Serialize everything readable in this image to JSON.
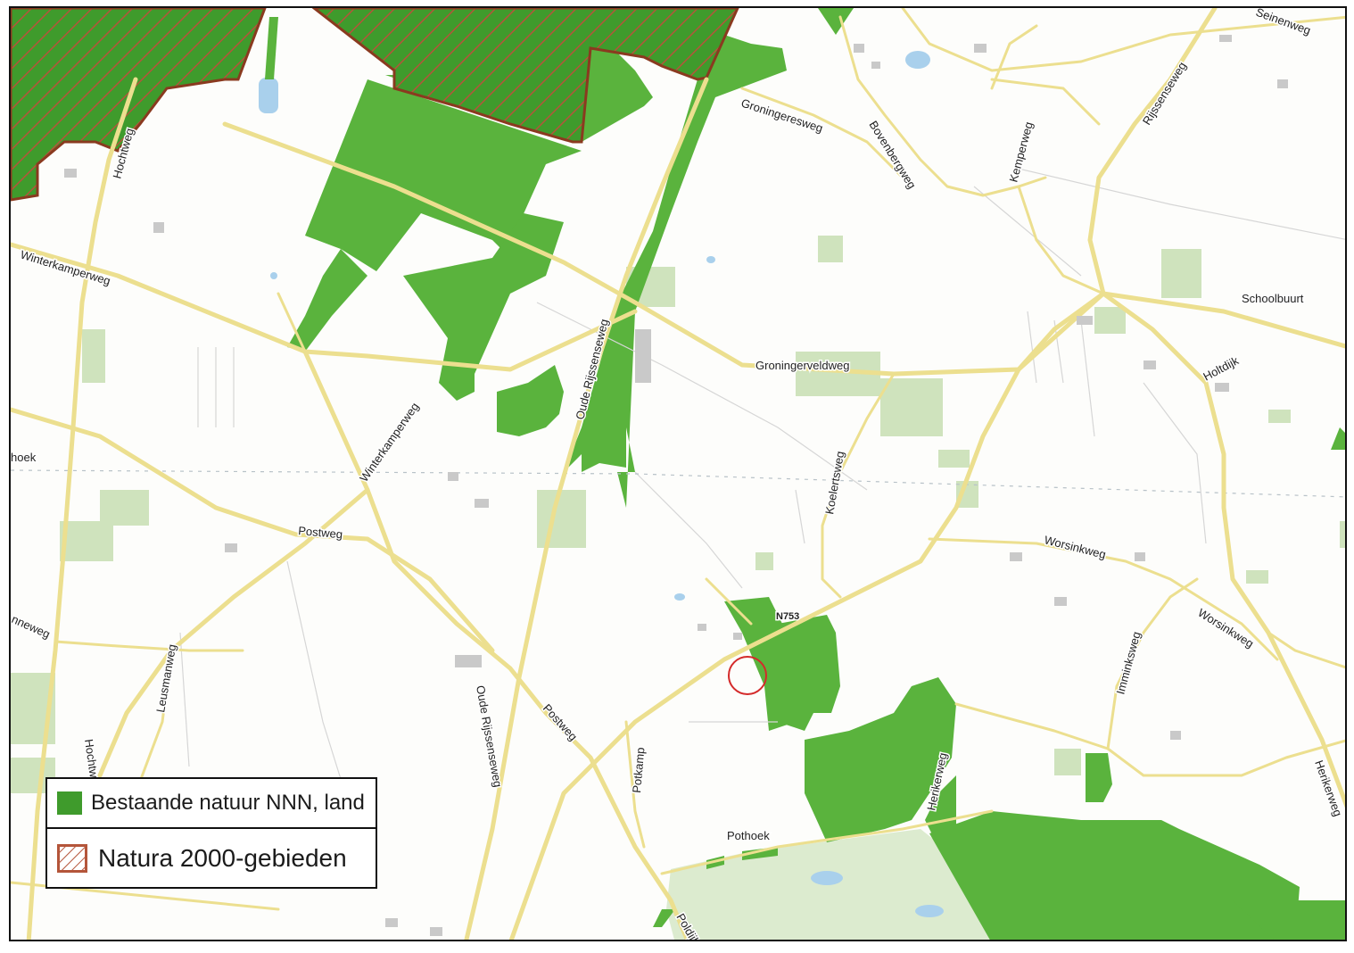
{
  "map": {
    "labels": {
      "winterkamperweg_nw": "Winterkamperweg",
      "winterkamperweg_c": "Winterkamperweg",
      "hochtweg_n": "Hochtweg",
      "hochtweg_s": "Hochtweg",
      "groningeresweg": "Groningeresweg",
      "bovenbergweg": "Bovenbergweg",
      "kemperweg": "Kemperweg",
      "rijssenseweg_ne": "Rijssenseweg",
      "seinenweg": "Seinenweg",
      "schoolbuurt": "Schoolbuurt",
      "holtdijk": "Holtdijk",
      "groningerveldweg": "Groningerveldweg",
      "oude_rijssenseweg_n": "Oude Rijssenseweg",
      "oude_rijssenseweg_s": "Oude Rijssenseweg",
      "koelertsweg": "Koelertsweg",
      "worsinkweg_n": "Worsinkweg",
      "worsinkweg_s": "Worsinkweg",
      "hoek": "hoek",
      "postweg_w": "Postweg",
      "postweg_s": "Postweg",
      "nneweg": "nneweg",
      "leusmanweg": "Leusmanweg",
      "potkamp": "Potkamp",
      "n753": "N753",
      "imminksweg": "Imminksweg",
      "herikerweg_c": "Herikerweg",
      "herikerweg_e": "Herikerweg",
      "pothoek": "Pothoek",
      "poldijk": "Poldijk"
    },
    "marker": {
      "shape": "circle",
      "color": "#d42a2a"
    },
    "colors": {
      "nnn_fill": "#5ab33d",
      "natura_fill": "#3f9b2c",
      "natura_hatch": "#b4553a",
      "natura_border": "#8a3a1f",
      "road": "#ecdf8f",
      "water": "#a9d0ec",
      "pale_green": "#cfe3bd"
    }
  },
  "legend": {
    "items": [
      {
        "label": "Bestaande natuur NNN, land",
        "swatch": "solid-green",
        "color": "#3f9b2c"
      },
      {
        "label": "Natura 2000-gebieden",
        "swatch": "hatched-brown-square",
        "color": "#b4553a"
      }
    ]
  }
}
